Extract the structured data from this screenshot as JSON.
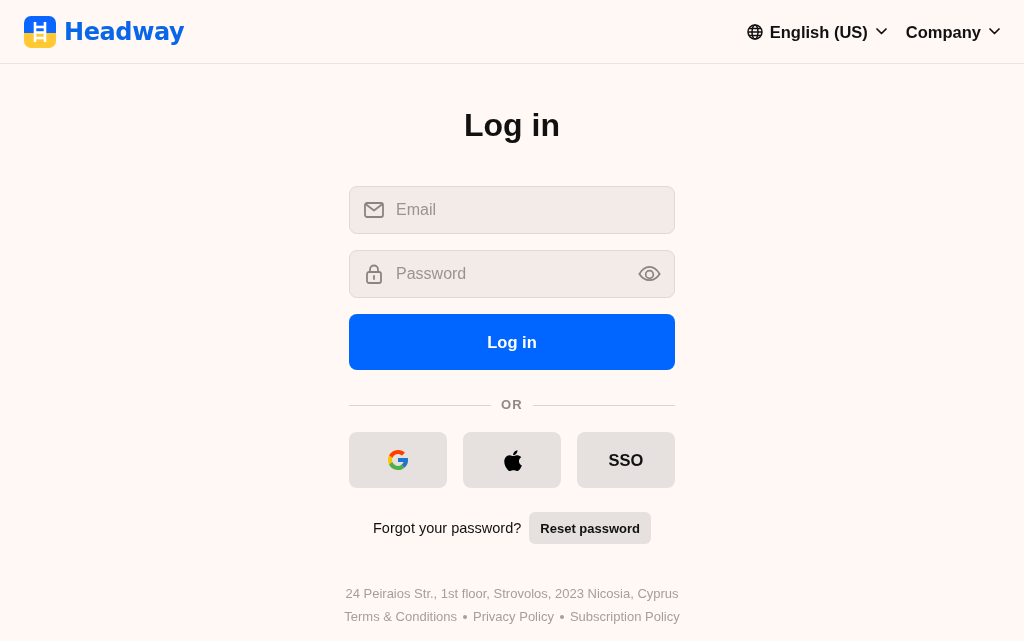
{
  "header": {
    "logo": "Headway",
    "menus": [
      {
        "kind": "language",
        "label": "English (US)"
      },
      {
        "kind": "plain",
        "label": "Company"
      }
    ]
  },
  "title": "Log in",
  "form": {
    "fields": [
      {
        "kind": "email",
        "placeholder": "Email"
      },
      {
        "kind": "password",
        "placeholder": "Password"
      }
    ],
    "submit": "Log in"
  },
  "divider": "OR",
  "social_buttons": [
    {
      "kind": "google"
    },
    {
      "kind": "apple"
    },
    {
      "kind": "sso",
      "label": "SSO"
    }
  ],
  "forgot": {
    "text": "Forgot your password?",
    "button": "Reset password"
  },
  "footer": {
    "address": "24 Peiraios Str., 1st floor, Strovolos, 2023 Nicosia, Cyprus",
    "links": [
      "Terms & Conditions",
      "Privacy Policy",
      "Subscription Policy"
    ]
  }
}
